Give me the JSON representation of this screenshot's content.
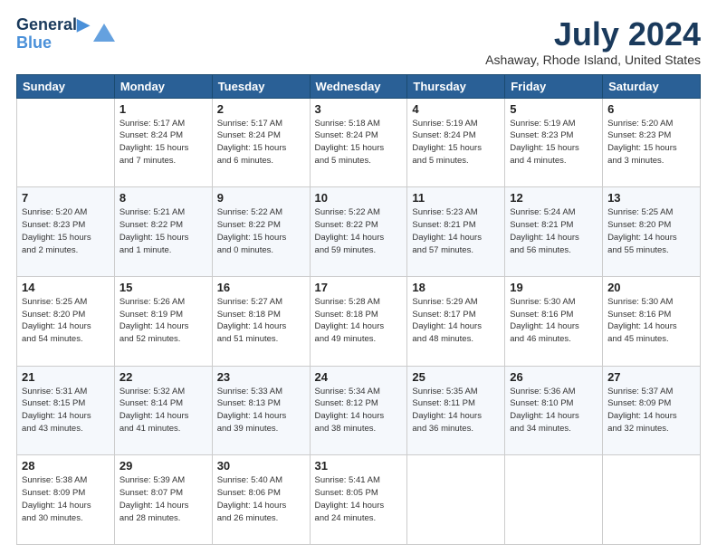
{
  "logo": {
    "line1": "General",
    "line2": "Blue",
    "icon_color": "#4a90d9"
  },
  "header": {
    "title": "July 2024",
    "location": "Ashaway, Rhode Island, United States"
  },
  "weekdays": [
    "Sunday",
    "Monday",
    "Tuesday",
    "Wednesday",
    "Thursday",
    "Friday",
    "Saturday"
  ],
  "weeks": [
    [
      {
        "day": "",
        "info": ""
      },
      {
        "day": "1",
        "info": "Sunrise: 5:17 AM\nSunset: 8:24 PM\nDaylight: 15 hours\nand 7 minutes."
      },
      {
        "day": "2",
        "info": "Sunrise: 5:17 AM\nSunset: 8:24 PM\nDaylight: 15 hours\nand 6 minutes."
      },
      {
        "day": "3",
        "info": "Sunrise: 5:18 AM\nSunset: 8:24 PM\nDaylight: 15 hours\nand 5 minutes."
      },
      {
        "day": "4",
        "info": "Sunrise: 5:19 AM\nSunset: 8:24 PM\nDaylight: 15 hours\nand 5 minutes."
      },
      {
        "day": "5",
        "info": "Sunrise: 5:19 AM\nSunset: 8:23 PM\nDaylight: 15 hours\nand 4 minutes."
      },
      {
        "day": "6",
        "info": "Sunrise: 5:20 AM\nSunset: 8:23 PM\nDaylight: 15 hours\nand 3 minutes."
      }
    ],
    [
      {
        "day": "7",
        "info": "Sunrise: 5:20 AM\nSunset: 8:23 PM\nDaylight: 15 hours\nand 2 minutes."
      },
      {
        "day": "8",
        "info": "Sunrise: 5:21 AM\nSunset: 8:22 PM\nDaylight: 15 hours\nand 1 minute."
      },
      {
        "day": "9",
        "info": "Sunrise: 5:22 AM\nSunset: 8:22 PM\nDaylight: 15 hours\nand 0 minutes."
      },
      {
        "day": "10",
        "info": "Sunrise: 5:22 AM\nSunset: 8:22 PM\nDaylight: 14 hours\nand 59 minutes."
      },
      {
        "day": "11",
        "info": "Sunrise: 5:23 AM\nSunset: 8:21 PM\nDaylight: 14 hours\nand 57 minutes."
      },
      {
        "day": "12",
        "info": "Sunrise: 5:24 AM\nSunset: 8:21 PM\nDaylight: 14 hours\nand 56 minutes."
      },
      {
        "day": "13",
        "info": "Sunrise: 5:25 AM\nSunset: 8:20 PM\nDaylight: 14 hours\nand 55 minutes."
      }
    ],
    [
      {
        "day": "14",
        "info": "Sunrise: 5:25 AM\nSunset: 8:20 PM\nDaylight: 14 hours\nand 54 minutes."
      },
      {
        "day": "15",
        "info": "Sunrise: 5:26 AM\nSunset: 8:19 PM\nDaylight: 14 hours\nand 52 minutes."
      },
      {
        "day": "16",
        "info": "Sunrise: 5:27 AM\nSunset: 8:18 PM\nDaylight: 14 hours\nand 51 minutes."
      },
      {
        "day": "17",
        "info": "Sunrise: 5:28 AM\nSunset: 8:18 PM\nDaylight: 14 hours\nand 49 minutes."
      },
      {
        "day": "18",
        "info": "Sunrise: 5:29 AM\nSunset: 8:17 PM\nDaylight: 14 hours\nand 48 minutes."
      },
      {
        "day": "19",
        "info": "Sunrise: 5:30 AM\nSunset: 8:16 PM\nDaylight: 14 hours\nand 46 minutes."
      },
      {
        "day": "20",
        "info": "Sunrise: 5:30 AM\nSunset: 8:16 PM\nDaylight: 14 hours\nand 45 minutes."
      }
    ],
    [
      {
        "day": "21",
        "info": "Sunrise: 5:31 AM\nSunset: 8:15 PM\nDaylight: 14 hours\nand 43 minutes."
      },
      {
        "day": "22",
        "info": "Sunrise: 5:32 AM\nSunset: 8:14 PM\nDaylight: 14 hours\nand 41 minutes."
      },
      {
        "day": "23",
        "info": "Sunrise: 5:33 AM\nSunset: 8:13 PM\nDaylight: 14 hours\nand 39 minutes."
      },
      {
        "day": "24",
        "info": "Sunrise: 5:34 AM\nSunset: 8:12 PM\nDaylight: 14 hours\nand 38 minutes."
      },
      {
        "day": "25",
        "info": "Sunrise: 5:35 AM\nSunset: 8:11 PM\nDaylight: 14 hours\nand 36 minutes."
      },
      {
        "day": "26",
        "info": "Sunrise: 5:36 AM\nSunset: 8:10 PM\nDaylight: 14 hours\nand 34 minutes."
      },
      {
        "day": "27",
        "info": "Sunrise: 5:37 AM\nSunset: 8:09 PM\nDaylight: 14 hours\nand 32 minutes."
      }
    ],
    [
      {
        "day": "28",
        "info": "Sunrise: 5:38 AM\nSunset: 8:09 PM\nDaylight: 14 hours\nand 30 minutes."
      },
      {
        "day": "29",
        "info": "Sunrise: 5:39 AM\nSunset: 8:07 PM\nDaylight: 14 hours\nand 28 minutes."
      },
      {
        "day": "30",
        "info": "Sunrise: 5:40 AM\nSunset: 8:06 PM\nDaylight: 14 hours\nand 26 minutes."
      },
      {
        "day": "31",
        "info": "Sunrise: 5:41 AM\nSunset: 8:05 PM\nDaylight: 14 hours\nand 24 minutes."
      },
      {
        "day": "",
        "info": ""
      },
      {
        "day": "",
        "info": ""
      },
      {
        "day": "",
        "info": ""
      }
    ]
  ]
}
